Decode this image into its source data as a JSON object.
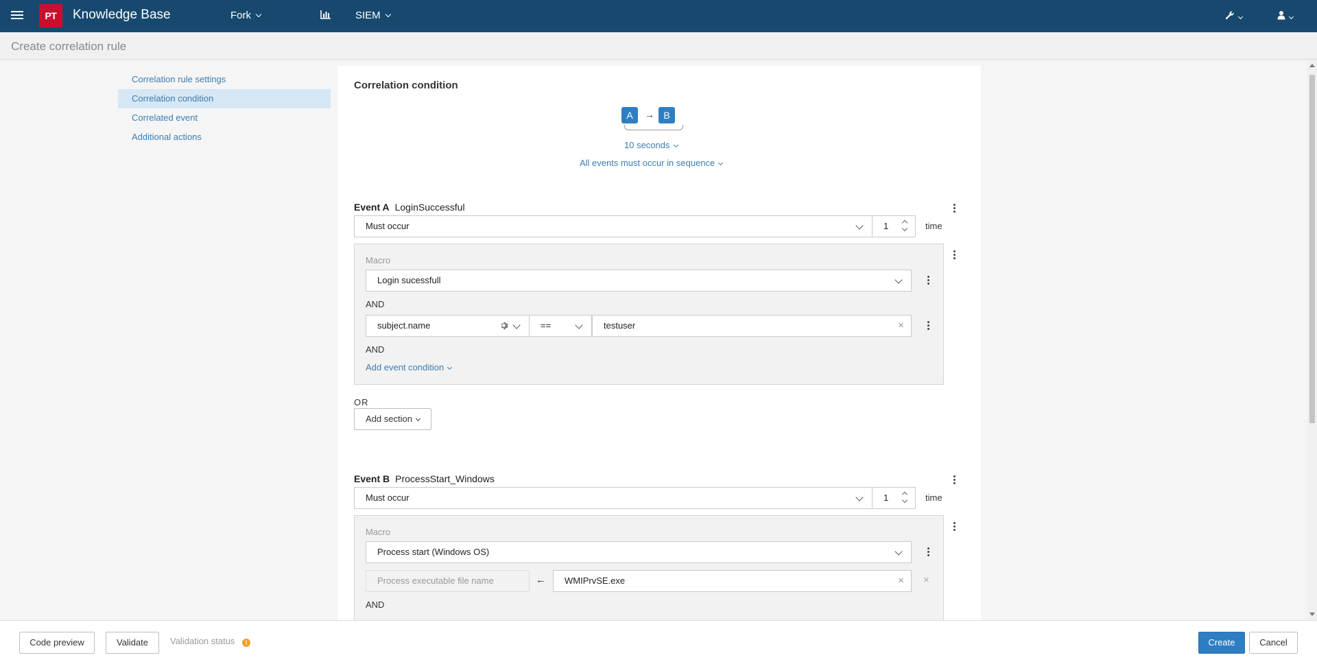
{
  "topbar": {
    "logo_text": "PT",
    "app_title": "Knowledge Base",
    "nav": {
      "fork_label": "Fork",
      "siem_label": "SIEM"
    }
  },
  "subheader": {
    "title": "Create correlation rule"
  },
  "sidenav": {
    "items": [
      {
        "label": "Correlation rule settings"
      },
      {
        "label": "Correlation condition"
      },
      {
        "label": "Correlated event"
      },
      {
        "label": "Additional actions"
      }
    ]
  },
  "panel": {
    "title": "Correlation condition",
    "sequence": {
      "a": "A",
      "b": "B",
      "arrow": "→",
      "interval": "10 seconds",
      "order": "All events must occur in sequence"
    },
    "event_a": {
      "prefix": "Event A",
      "name": "LoginSuccessful",
      "occurrence": "Must occur",
      "count": "1",
      "unit": "time",
      "macro_label": "Macro",
      "macro_value": "Login sucessfull",
      "and_label": "AND",
      "field": "subject.name",
      "operator": "==",
      "value": "testuser",
      "and_label_2": "AND",
      "add_condition": "Add event condition"
    },
    "or_label": "OR",
    "add_section": "Add section",
    "event_b": {
      "prefix": "Event B",
      "name": "ProcessStart_Windows",
      "occurrence": "Must occur",
      "count": "1",
      "unit": "time",
      "macro_label": "Macro",
      "macro_value": "Process start (Windows OS)",
      "field_placeholder": "Process executable file name",
      "assign_arrow": "←",
      "value": "WMIPrvSE.exe",
      "and_label": "AND"
    }
  },
  "footer": {
    "code_preview": "Code preview",
    "validate": "Validate",
    "validation_status": "Validation status",
    "info_glyph": "!",
    "create": "Create",
    "cancel": "Cancel"
  },
  "colors": {
    "topbar": "#17496f",
    "accent": "#2f7ec4",
    "logo": "#c8102e",
    "link": "#3d7cb0",
    "warning": "#f0a028"
  }
}
